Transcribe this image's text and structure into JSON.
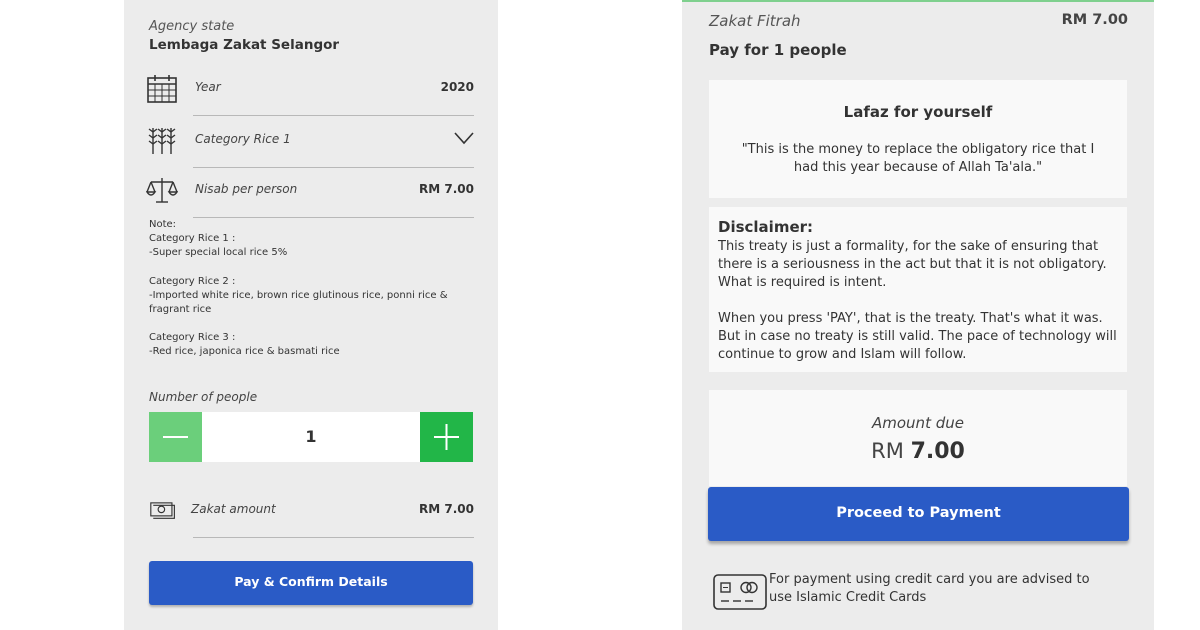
{
  "left": {
    "agency_label": "Agency state",
    "agency_value": "Lembaga Zakat Selangor",
    "year": {
      "label": "Year",
      "value": "2020",
      "icon": "calendar-icon"
    },
    "category": {
      "label": "Category Rice 1",
      "icon": "wheat-icon"
    },
    "nisab": {
      "label": "Nisab per person",
      "value": "RM 7.00",
      "icon": "scale-icon"
    },
    "note": {
      "heading": "Note:",
      "cat1_title": "Category Rice 1 :",
      "cat1_desc": "-Super special local rice 5%",
      "cat2_title": "Category Rice 2 :",
      "cat2_desc_1": "-Imported white rice, brown rice glutinous rice, ponni rice &",
      "cat2_desc_2": "fragrant rice",
      "cat3_title": "Category Rice 3 :",
      "cat3_desc": "-Red rice, japonica rice & basmati rice"
    },
    "people_label": "Number of people",
    "people_count": "1",
    "zakat": {
      "label": "Zakat amount",
      "value": "RM 7.00",
      "icon": "money-icon"
    },
    "pay_button": "Pay & Confirm Details",
    "colors": {
      "minus": "#6bcf7b",
      "plus": "#22b648",
      "button": "#2a5bc6"
    }
  },
  "right": {
    "zakat_label": "Zakat Fitrah",
    "zakat_amount": "RM 7.00",
    "pay_for": "Pay for 1 people",
    "lafaz_title": "Lafaz for yourself",
    "lafaz_text": "\"This is the money to replace the obligatory rice that I had this year because of Allah Ta'ala.\"",
    "disclaimer_title": "Disclaimer:",
    "disclaimer_p1": "This treaty is just a formality, for the sake of ensuring that there is a seriousness in the act but that it is not obligatory. What is required is intent.",
    "disclaimer_p2": "When you press 'PAY', that is the treaty. That's what it was. But in case no treaty is still valid. The pace of technology will continue to grow and Islam will follow.",
    "amount_due_label": "Amount due",
    "amount_due_currency": "RM",
    "amount_due_value": "7.00",
    "proceed_button": "Proceed to Payment",
    "cc_note": "For payment using credit card you are advised to use Islamic Credit Cards",
    "colors": {
      "button": "#2a5bc6",
      "accent": "#7fd08e"
    }
  }
}
